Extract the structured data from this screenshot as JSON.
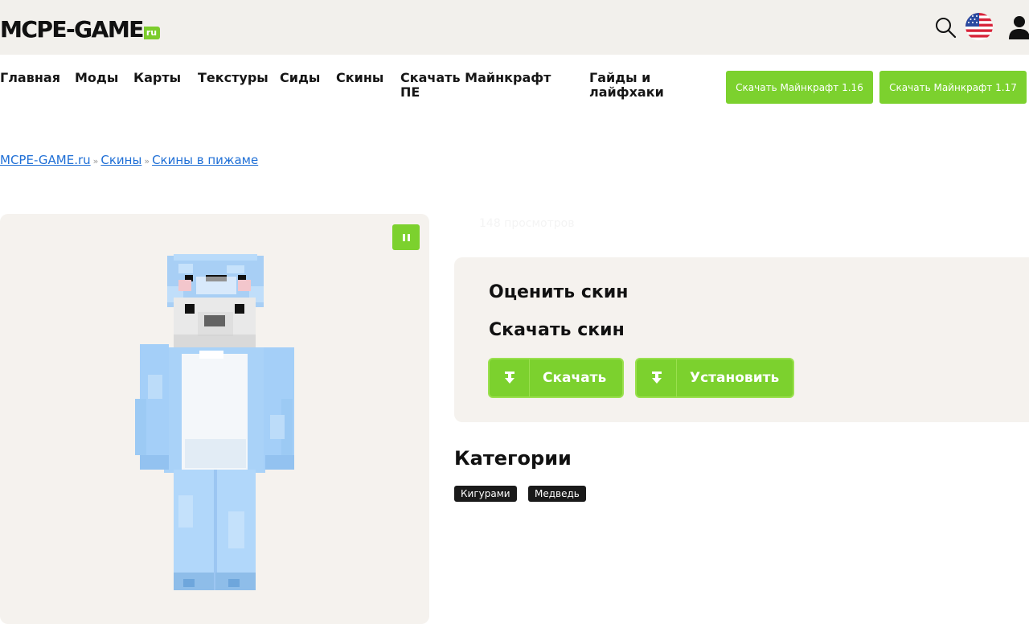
{
  "header": {
    "logo_main": "MCPE-GAME",
    "logo_ru": "ru",
    "icons": {
      "search": "search-icon",
      "language": "us-flag-icon",
      "user": "user-icon"
    }
  },
  "nav": {
    "items": [
      "Главная",
      "Моды",
      "Карты",
      "Текстуры",
      "Сиды",
      "Скины",
      "Скачать Майнкрафт ПЕ",
      "Гайды и лайфхаки"
    ],
    "buttons": [
      "Скачать Майнкрафт 1.16",
      "Скачать Майнкрафт 1.17"
    ]
  },
  "breadcrumb": {
    "items": [
      "MCPE-GAME.ru",
      "Скины",
      "Скины в пижаме"
    ],
    "separator": "»"
  },
  "skin": {
    "views": "148 просмотров",
    "pause_icon": "pause-icon"
  },
  "actions": {
    "rate_title": "Оценить скин",
    "download_title": "Скачать скин",
    "download_label": "Скачать",
    "install_label": "Установить",
    "button_icon": "download-arrow-icon"
  },
  "categories": {
    "title": "Категории",
    "tags": [
      "Кигурами",
      "Медведь"
    ]
  },
  "colors": {
    "accent_green": "#7cd12e",
    "link_blue": "#1f6fd6",
    "panel_bg": "#f5f2ee",
    "header_bg": "#f2f0ec"
  }
}
